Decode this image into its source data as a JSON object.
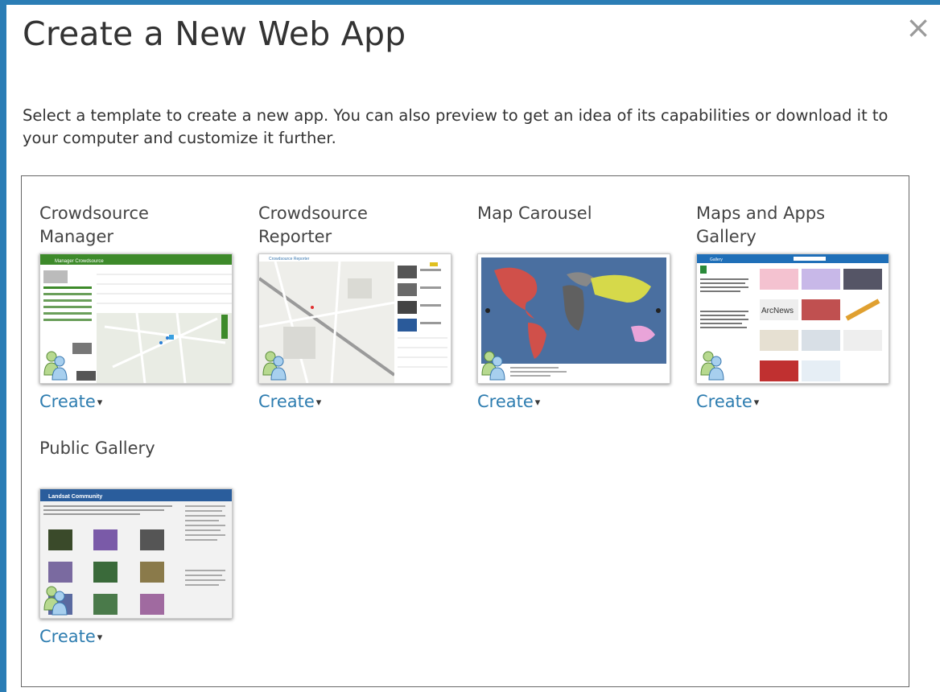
{
  "dialog": {
    "title": "Create a New Web App",
    "close_glyph": "×",
    "description": "Select a template to create a new app. You can also preview to get an idea of its capabilities or download it to your computer and customize it further."
  },
  "templates": [
    {
      "name": "Crowdsource Manager",
      "thumb_header": "Manager Crowdsource",
      "create_label": "Create",
      "caret": "▾"
    },
    {
      "name": "Crowdsource Reporter",
      "thumb_header": "Crowdsource Reporter",
      "create_label": "Create",
      "caret": "▾"
    },
    {
      "name": "Map Carousel",
      "create_label": "Create",
      "caret": "▾"
    },
    {
      "name": "Maps and Apps Gallery",
      "thumb_header": "Gallery",
      "thumb_overlay": "ArcNews",
      "create_label": "Create",
      "caret": "▾"
    },
    {
      "name": "Public Gallery",
      "thumb_header": "Landsat Community",
      "create_label": "Create",
      "caret": "▾"
    }
  ],
  "icons": {
    "close": "close-icon",
    "dropdown": "caret-down-icon",
    "template_owner": "users-icon"
  },
  "colors": {
    "frame_blue": "#2b7db5",
    "link_blue": "#2e7db0",
    "manager_green": "#3d8a2a",
    "gallery_blue": "#1f6fb8",
    "landsat_blue": "#2a5d9c"
  }
}
